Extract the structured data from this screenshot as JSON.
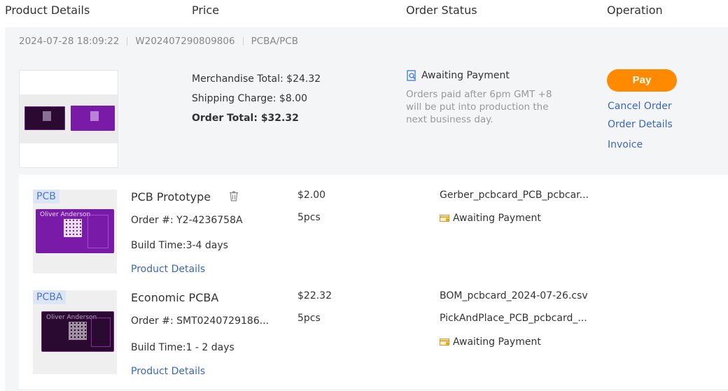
{
  "header": {
    "col_product": "Product Details",
    "col_price": "Price",
    "col_status": "Order Status",
    "col_operation": "Operation"
  },
  "order": {
    "date": "2024-07-28 18:09:22",
    "order_no": "W202407290809806",
    "category": "PCBA/PCB",
    "merchandise_total": "Merchandise Total: $24.32",
    "shipping_charge": "Shipping Charge: $8.00",
    "order_total": "Order Total: $32.32",
    "status": "Awaiting Payment",
    "status_note": "Orders paid after 6pm GMT +8 will be put into production the next business day.",
    "pay_label": "Pay",
    "cancel_label": "Cancel Order",
    "details_label": "Order Details",
    "invoice_label": "Invoice"
  },
  "items": [
    {
      "tag": "PCB",
      "title": "PCB Prototype",
      "order_no": "Order #: Y2-4236758A",
      "build_time": "Build Time:3-4 days",
      "details_link": "Product Details",
      "price": "$2.00",
      "qty": "5pcs",
      "file": "Gerber_pcbcard_PCB_pcbcar...",
      "status": "Awaiting Payment",
      "board_name": "Oliver Anderson"
    },
    {
      "tag": "PCBA",
      "title": "Economic PCBA",
      "order_no": "Order #: SMT0240729186...",
      "build_time": "Build Time:1 - 2 days",
      "details_link": "Product Details",
      "price": "$22.32",
      "qty": "5pcs",
      "file": "BOM_pcbcard_2024-07-26.csv",
      "file2": "PickAndPlace_PCB_pcbcard_...",
      "status": "Awaiting Payment",
      "board_name": "Oliver Anderson"
    }
  ],
  "colors": {
    "accent_orange": "#ff8a00",
    "link_blue": "#3a66c4",
    "board_purple": "#7a1aa8",
    "board_dark": "#2a0a30"
  },
  "icons": [
    "search-document-icon",
    "trash-icon",
    "payment-card-icon"
  ]
}
